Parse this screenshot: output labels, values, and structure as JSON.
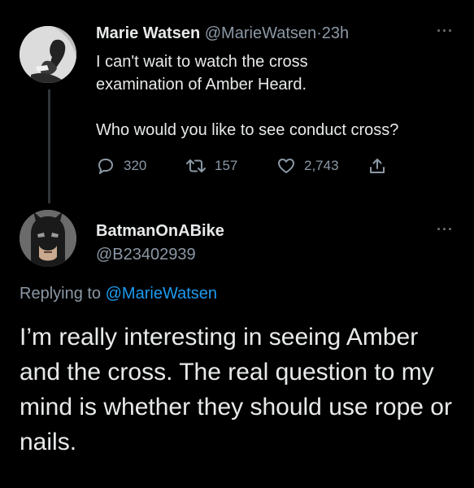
{
  "tweet": {
    "author_name": "Marie Watsen",
    "author_handle": "@MarieWatsen",
    "separator": "·",
    "time": "23h",
    "more": "···",
    "text_line1": "I can't wait to watch the cross",
    "text_line2": "examination of Amber Heard.",
    "text_line3": "Who would you like to see conduct cross?",
    "replies": "320",
    "retweets": "157",
    "likes": "2,743",
    "icons": [
      "reply-icon",
      "retweet-icon",
      "like-icon",
      "share-icon"
    ]
  },
  "reply": {
    "author_name": "BatmanOnABike",
    "author_handle": "@B23402939",
    "more": "···",
    "replying_prefix": "Replying to",
    "replying_to": "@MarieWatsen",
    "text": "I’m really interesting in seeing Amber and the cross. The real question to my mind is whether they should use rope or nails."
  },
  "colors": {
    "background": "#000000",
    "text": "#e7e9ea",
    "secondary": "#8b98a5",
    "link": "#1d9bf0",
    "thread_line": "#333639"
  }
}
